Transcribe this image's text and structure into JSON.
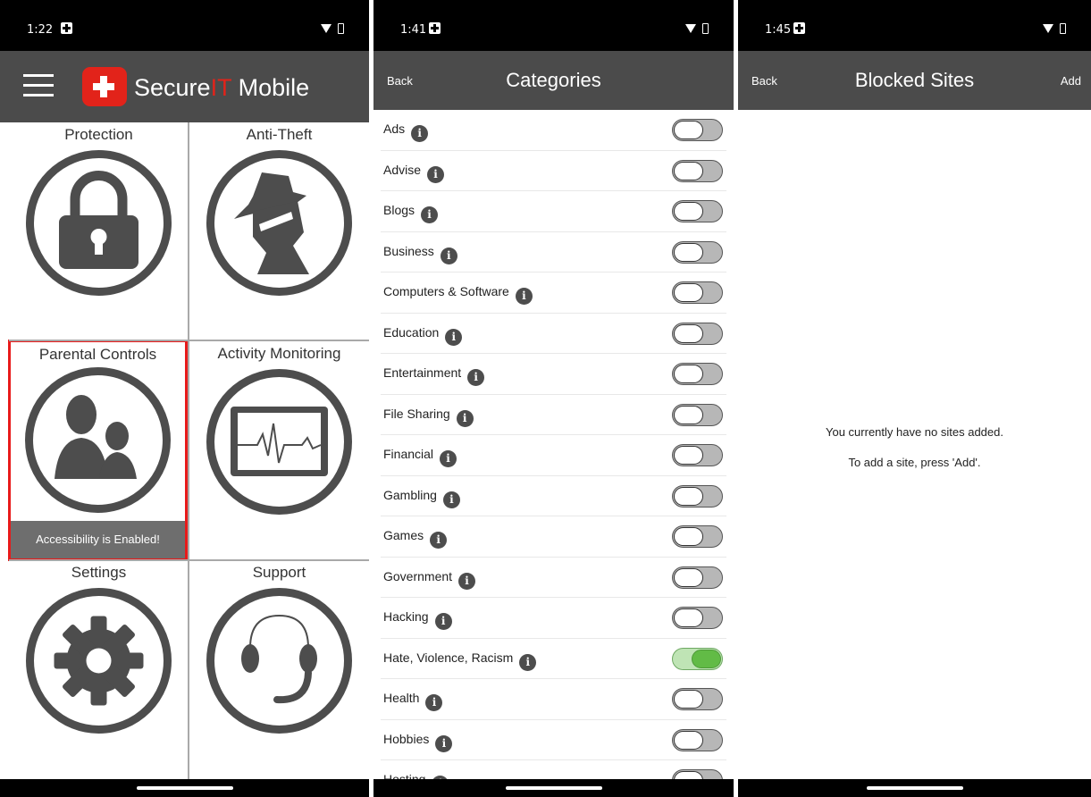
{
  "screen1": {
    "status_time": "1:22",
    "app_name_part1": "Secure",
    "app_name_part2": "IT",
    "app_name_part3": " Mobile",
    "tiles": [
      {
        "label": "Protection",
        "icon": "lock-icon"
      },
      {
        "label": "Anti-Theft",
        "icon": "spy-icon"
      },
      {
        "label": "Parental Controls",
        "icon": "parent-child-icon"
      },
      {
        "label": "Activity Monitoring",
        "icon": "heartbeat-monitor-icon"
      },
      {
        "label": "Settings",
        "icon": "gear-icon"
      },
      {
        "label": "Support",
        "icon": "headset-icon"
      }
    ],
    "accessibility_banner": "Accessibility is Enabled!",
    "colors": {
      "accent": "#e2231a",
      "header": "#4b4b4b",
      "selected_border": "#e81a1a"
    }
  },
  "screen2": {
    "status_time": "1:41",
    "back_label": "Back",
    "title": "Categories",
    "categories": [
      {
        "label": "Ads",
        "enabled": false
      },
      {
        "label": "Advise",
        "enabled": false
      },
      {
        "label": "Blogs",
        "enabled": false
      },
      {
        "label": "Business",
        "enabled": false
      },
      {
        "label": "Computers & Software",
        "enabled": false
      },
      {
        "label": "Education",
        "enabled": false
      },
      {
        "label": "Entertainment",
        "enabled": false
      },
      {
        "label": "File Sharing",
        "enabled": false
      },
      {
        "label": "Financial",
        "enabled": false
      },
      {
        "label": "Gambling",
        "enabled": false
      },
      {
        "label": "Games",
        "enabled": false
      },
      {
        "label": "Government",
        "enabled": false
      },
      {
        "label": "Hacking",
        "enabled": false
      },
      {
        "label": "Hate, Violence, Racism",
        "enabled": true
      },
      {
        "label": "Health",
        "enabled": false
      },
      {
        "label": "Hobbies",
        "enabled": false
      },
      {
        "label": "Hosting",
        "enabled": false
      }
    ],
    "info_glyph": "i",
    "colors": {
      "toggle_on": "#62bb46",
      "toggle_off": "#b7b7b7"
    }
  },
  "screen3": {
    "status_time": "1:45",
    "back_label": "Back",
    "title": "Blocked Sites",
    "add_label": "Add",
    "empty_line1": "You currently have no sites added.",
    "empty_line2": "To add a site, press 'Add'."
  }
}
